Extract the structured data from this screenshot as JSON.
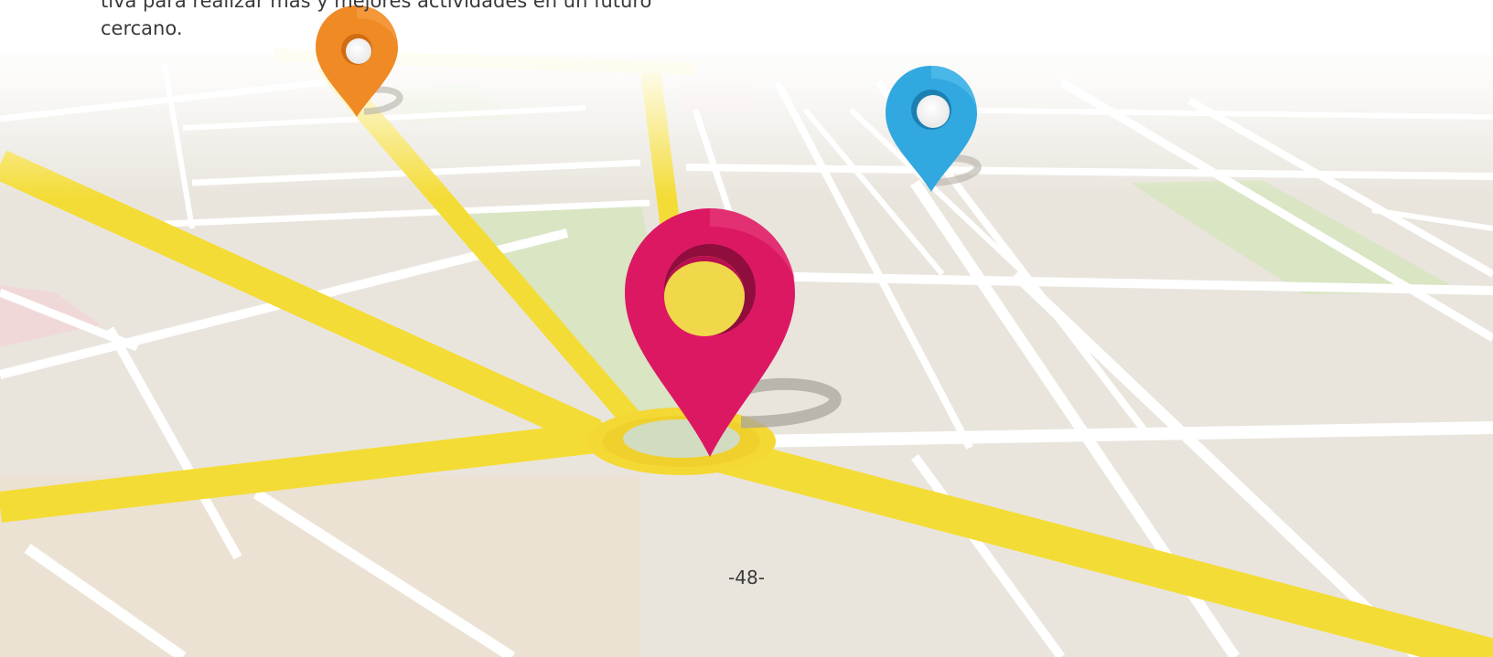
{
  "body_text": {
    "line_1": "tiva para realizar más y mejores actividades en un futuro",
    "line_2": "cercano."
  },
  "page_number": "-48-",
  "map": {
    "colors": {
      "ground": "#e9e5dd",
      "street": "#ffffff",
      "main_road": "#f3dc3b",
      "park": "#d9e5c3",
      "pink_area": "#f1d8d8"
    },
    "pins": [
      {
        "name": "orange",
        "color": "#ef8a25"
      },
      {
        "name": "blue",
        "color": "#31a8e0"
      },
      {
        "name": "magenta",
        "color": "#dc1863"
      }
    ]
  }
}
